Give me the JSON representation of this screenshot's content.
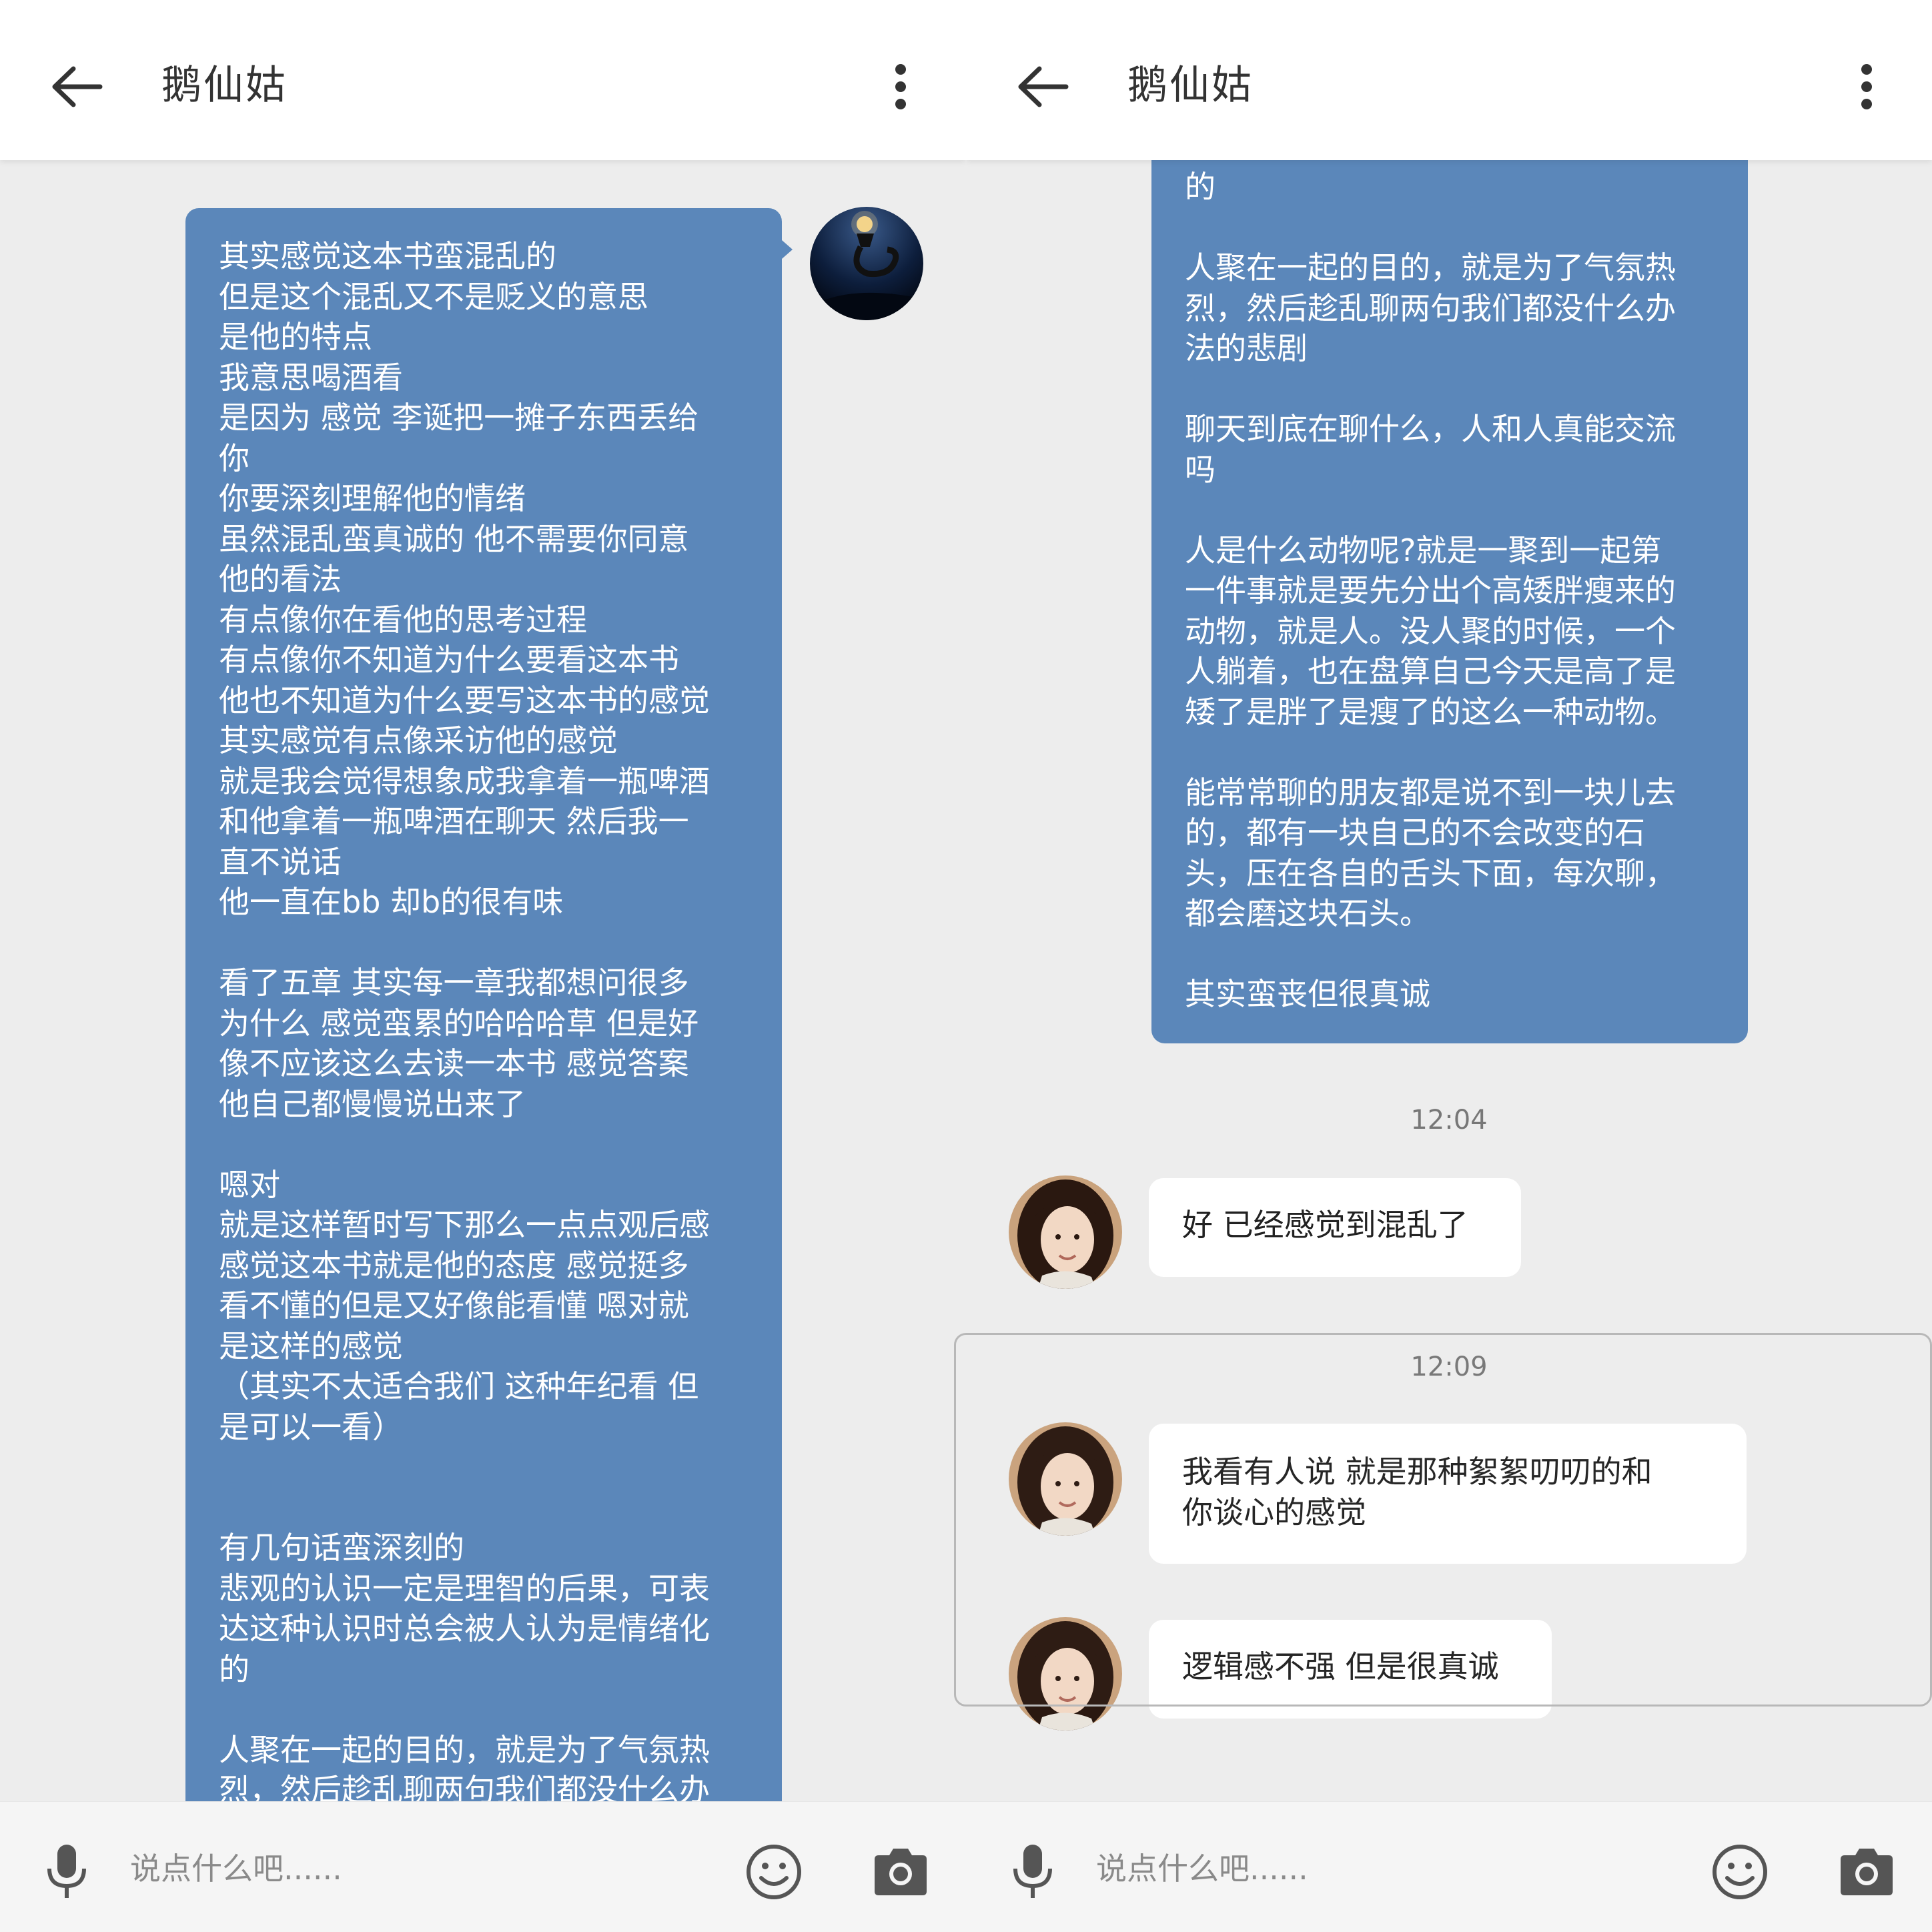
{
  "left": {
    "header": {
      "title": "鹅仙姑",
      "back_icon": "arrow-left-icon",
      "more_icon": "more-vertical-icon"
    },
    "messages": [
      {
        "sender": "me",
        "text": "其实感觉这本书蛮混乱的\n但是这个混乱又不是贬义的意思\n是他的特点\n我意思喝酒看\n是因为 感觉 李诞把一摊子东西丢给\n你\n你要深刻理解他的情绪\n虽然混乱蛮真诚的 他不需要你同意\n他的看法\n有点像你在看他的思考过程\n有点像你不知道为什么要看这本书\n他也不知道为什么要写这本书的感觉\n其实感觉有点像采访他的感觉\n就是我会觉得想象成我拿着一瓶啤酒\n和他拿着一瓶啤酒在聊天 然后我一\n直不说话\n他一直在bb 却b的很有味\n\n看了五章 其实每一章我都想问很多\n为什么 感觉蛮累的哈哈哈草 但是好\n像不应该这么去读一本书 感觉答案\n他自己都慢慢说出来了\n\n嗯对\n就是这样暂时写下那么一点点观后感\n感觉这本书就是他的态度 感觉挺多\n看不懂的但是又好像能看懂 嗯对就\n是这样的感觉\n（其实不太适合我们 这种年纪看 但\n是可以一看）\n\n\n有几句话蛮深刻的\n悲观的认识一定是理智的后果，可表\n达这种认识时总会被人认为是情绪化\n的\n\n人聚在一起的目的，就是为了气氛热\n烈，然后趁乱聊两句我们都没什么办\n法的悲剧"
      }
    ],
    "footer": {
      "placeholder": "说点什么吧......",
      "mic_icon": "microphone-icon",
      "emoji_icon": "smiley-icon",
      "camera_icon": "camera-icon"
    }
  },
  "right": {
    "header": {
      "title": "鹅仙姑",
      "back_icon": "arrow-left-icon",
      "more_icon": "more-vertical-icon"
    },
    "messages": [
      {
        "sender": "me",
        "text": "的\n\n人聚在一起的目的，就是为了气氛热\n烈，然后趁乱聊两句我们都没什么办\n法的悲剧\n\n聊天到底在聊什么，人和人真能交流\n吗\n\n人是什么动物呢?就是一聚到一起第\n一件事就是要先分出个高矮胖瘦来的\n动物，就是人。没人聚的时候，一个\n人躺着，也在盘算自己今天是高了是\n矮了是胖了是瘦了的这么一种动物。\n\n能常常聊的朋友都是说不到一块儿去\n的，都有一块自己的不会改变的石\n头，压在各自的舌头下面，每次聊，\n都会磨这块石头。\n\n其实蛮丧但很真诚"
      },
      {
        "type": "time",
        "text": "12:04"
      },
      {
        "sender": "them",
        "text": "好 已经感觉到混乱了"
      },
      {
        "type": "time",
        "text": "12:09"
      },
      {
        "sender": "them",
        "text": "我看有人说 就是那种絮絮叨叨的和\n你谈心的感觉"
      },
      {
        "sender": "them",
        "text": "逻辑感不强 但是很真诚"
      }
    ],
    "footer": {
      "placeholder": "说点什么吧......",
      "mic_icon": "microphone-icon",
      "emoji_icon": "smiley-icon",
      "camera_icon": "camera-icon"
    }
  },
  "colors": {
    "my_bubble": "#5b87ba",
    "their_bubble": "#ffffff",
    "background": "#ededed"
  }
}
